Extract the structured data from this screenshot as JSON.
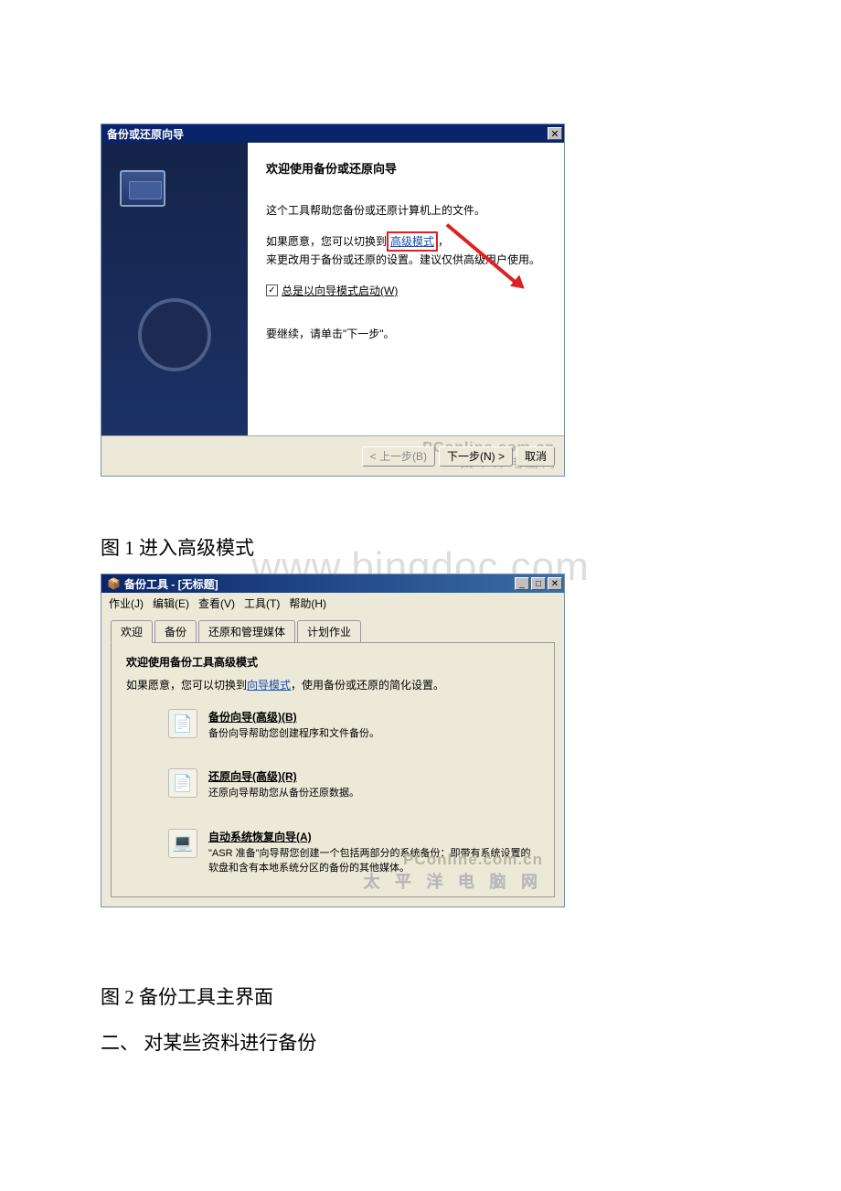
{
  "watermark": "www.bingdoc.com",
  "wizard": {
    "title": "备份或还原向导",
    "close": "✕",
    "heading": "欢迎使用备份或还原向导",
    "line1": "这个工具帮助您备份或还原计算机上的文件。",
    "line2a": "如果愿意，您可以切换到",
    "advanced_link": "高级模式",
    "line2b": "，",
    "line3": "来更改用于备份或还原的设置。建议仅供高级用户使用。",
    "checkbox_label": "总是以向导模式启动(W)",
    "line4": "要继续，请单击\"下一步\"。",
    "btn_back": "< 上一步(B)",
    "btn_next": "下一步(N) >",
    "btn_cancel": "取消",
    "brand_top": "PConline.com.cn",
    "brand_bottom": "太 平 洋 电 脑 网"
  },
  "caption1": "图 1 进入高级模式",
  "tool": {
    "title": "备份工具 - [无标题]",
    "winbtns": {
      "min": "_",
      "max": "□",
      "close": "✕"
    },
    "menu": {
      "job": "作业(J)",
      "edit": "编辑(E)",
      "view": "查看(V)",
      "tools": "工具(T)",
      "help": "帮助(H)"
    },
    "tabs": {
      "welcome": "欢迎",
      "backup": "备份",
      "restore": "还原和管理媒体",
      "schedule": "计划作业"
    },
    "panel_heading": "欢迎使用备份工具高级模式",
    "panel_subtext_a": "如果愿意，您可以切换到",
    "wizard_link": "向导模式",
    "panel_subtext_b": "，使用备份或还原的简化设置。",
    "options": [
      {
        "title": "备份向导(高级)(B)",
        "desc": "备份向导帮助您创建程序和文件备份。",
        "icon": "📄"
      },
      {
        "title": "还原向导(高级)(R)",
        "desc": "还原向导帮助您从备份还原数据。",
        "icon": "📄"
      },
      {
        "title": "自动系统恢复向导(A)",
        "desc": "\"ASR 准备\"向导帮您创建一个包括两部分的系统备份：即带有系统设置的软盘和含有本地系统分区的备份的其他媒体。",
        "icon": "💻"
      }
    ],
    "brand_top": "PConline.com.cn",
    "brand_bottom": "太 平 洋 电 脑 网"
  },
  "caption2": "图 2 备份工具主界面",
  "section2_title": "二、 对某些资料进行备份"
}
